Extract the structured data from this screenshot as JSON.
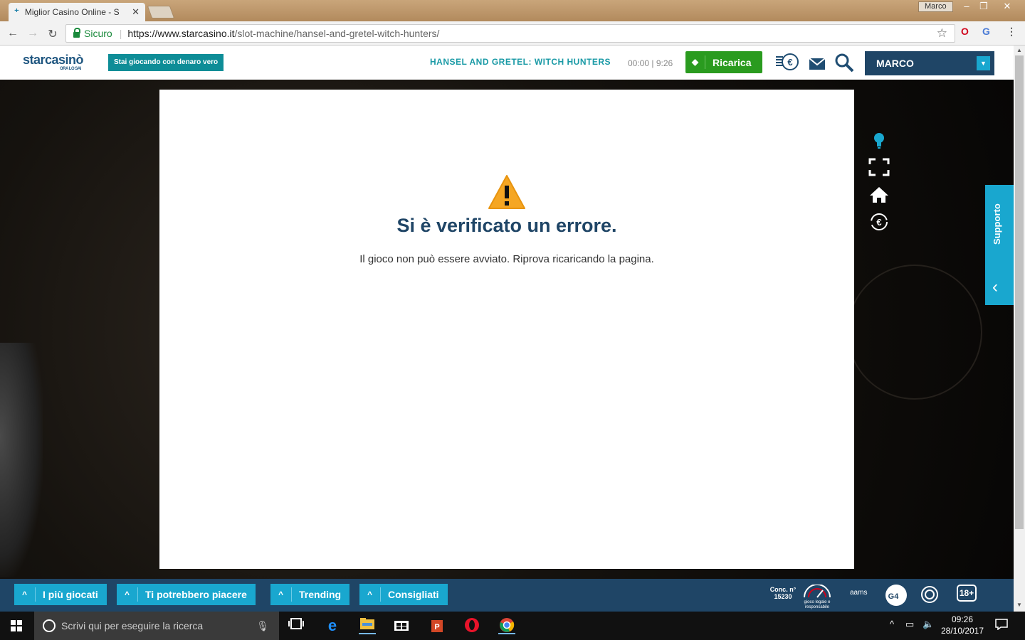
{
  "browser": {
    "tab_title": "Miglior Casino Online - S",
    "profile_name": "Marco",
    "secure_label": "Sicuro",
    "url_domain": "https://www.starcasino.it",
    "url_path": "/slot-machine/hansel-and-gretel-witch-hunters/"
  },
  "site": {
    "logo_text": "starcasinò",
    "logo_tagline": "ORA LO SAI",
    "real_money_badge": "Stai giocando con denaro vero",
    "game_title": "HANSEL AND GRETEL: WITCH HUNTERS",
    "timer": "00:00 | 9:26",
    "recharge_label": "Ricarica",
    "user_name": "MARCO"
  },
  "error": {
    "title": "Si è verificato un errore.",
    "message": "Il gioco non può essere avviato. Riprova ricaricando la pagina."
  },
  "support_label": "Supporto",
  "footer": {
    "buttons": [
      "I più giocati",
      "Ti potrebbero piacere",
      "Trending",
      "Consigliati"
    ],
    "concession": "Conc. n° 15230",
    "responsible_text": "gioco legale e responsabile",
    "aams": "aams",
    "age": "18+"
  },
  "taskbar": {
    "search_placeholder": "Scrivi qui per eseguire la ricerca",
    "time": "09:26",
    "date": "28/10/2017"
  },
  "colors": {
    "brand_navy": "#1f4566",
    "brand_cyan": "#19a7cf",
    "recharge_green": "#2a9b1f",
    "teal_badge": "#0e8d97"
  }
}
